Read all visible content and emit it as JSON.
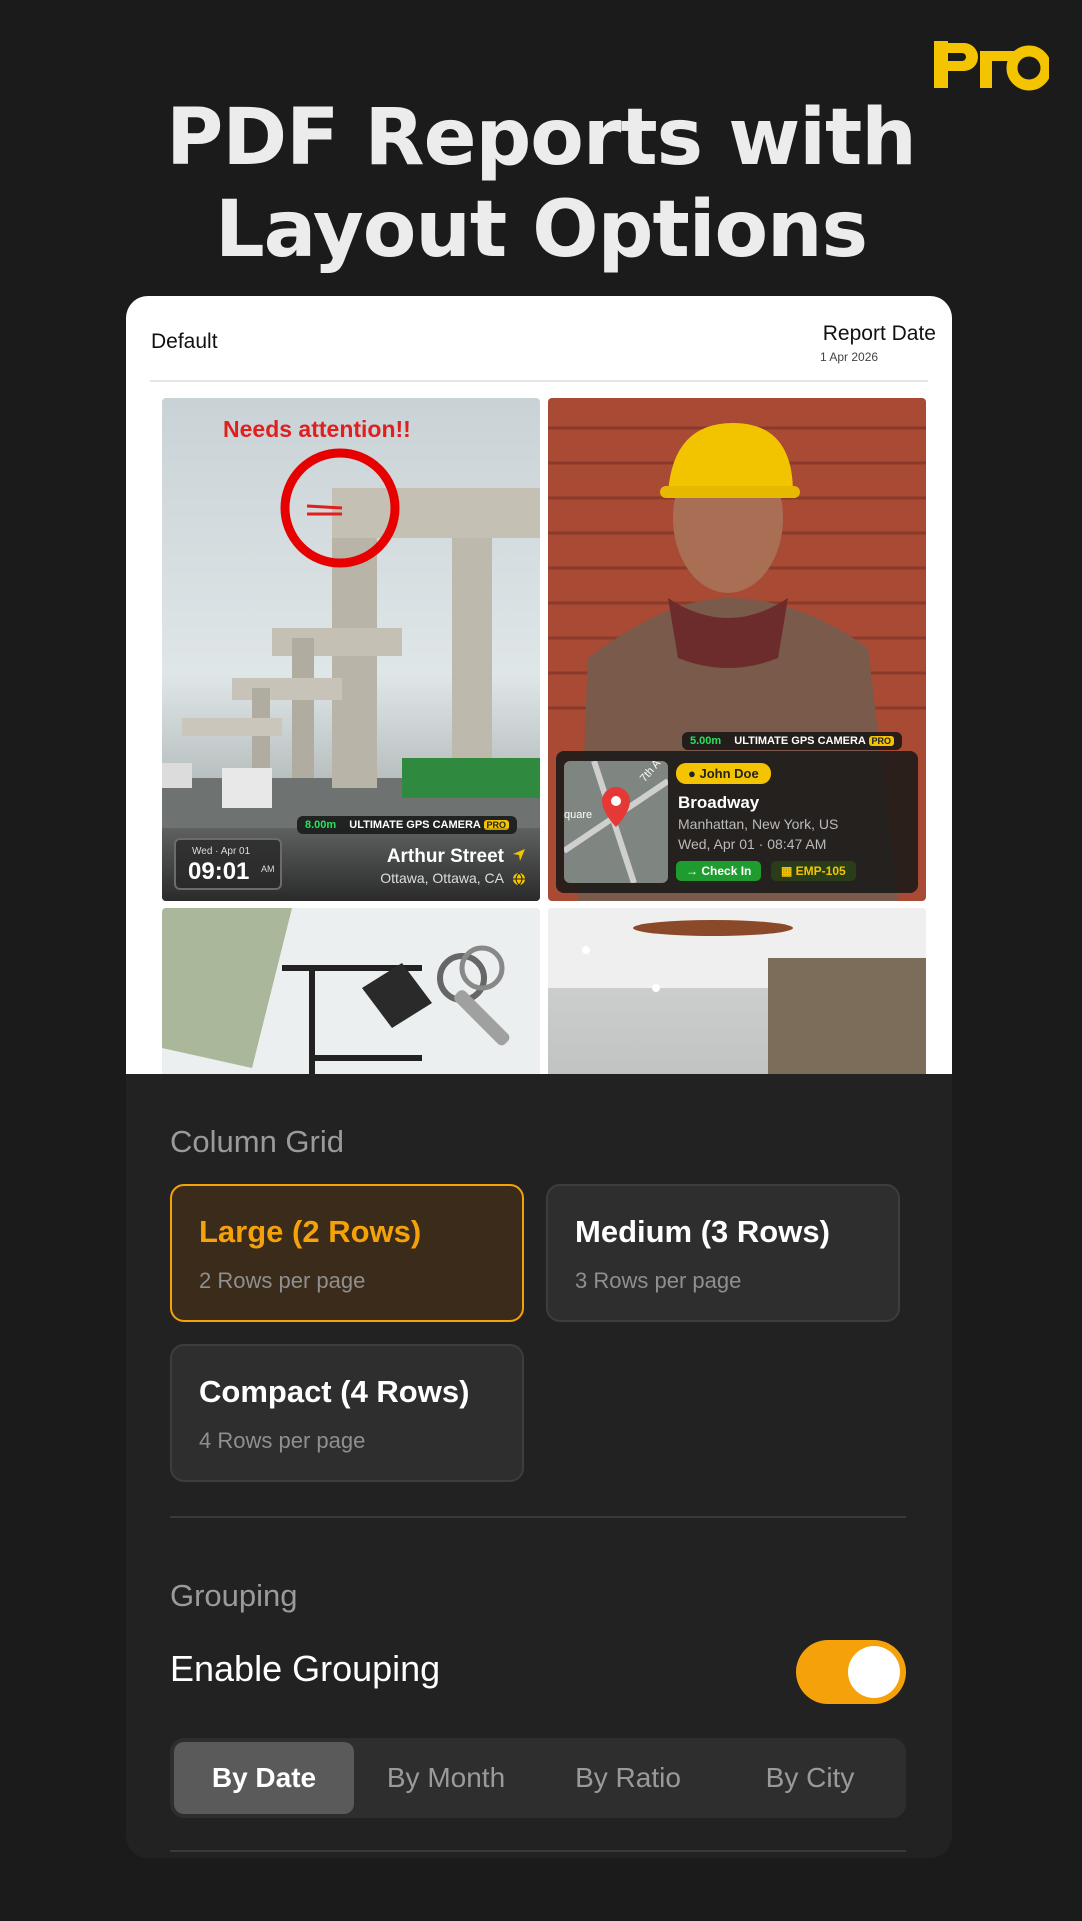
{
  "hero": {
    "line1": "PDF Reports with",
    "line2": "Layout Options"
  },
  "brand": {
    "logo_text": "pro",
    "accent": "#f5c400"
  },
  "report": {
    "layout_name": "Default",
    "date_label": "Report Date",
    "date_value": "1 Apr 2026"
  },
  "photos": {
    "photo1": {
      "annotation": "Needs attention!!",
      "distance": "8.00m",
      "camera": "ULTIMATE GPS CAMERA",
      "pro_tag": "PRO",
      "date": "Wed · Apr 01",
      "time": "09:01",
      "ampm": "AM",
      "street": "Arthur Street",
      "city": "Ottawa, Ottawa, CA"
    },
    "photo2": {
      "distance": "5.00m",
      "camera": "ULTIMATE GPS CAMERA",
      "pro_tag": "PRO",
      "map_label_1": "7th A",
      "map_label_2": "quare",
      "user": "John Doe",
      "street": "Broadway",
      "city": "Manhattan, New York, US",
      "datetime": "Wed, Apr 01 · 08:47 AM",
      "status": "Check In",
      "employee": "EMP-105"
    }
  },
  "column_grid": {
    "title": "Column Grid",
    "options": [
      {
        "title": "Large (2 Rows)",
        "sub": "2 Rows per page",
        "selected": true
      },
      {
        "title": "Medium (3 Rows)",
        "sub": "3 Rows per page",
        "selected": false
      },
      {
        "title": "Compact (4 Rows)",
        "sub": "4 Rows per page",
        "selected": false
      }
    ]
  },
  "grouping": {
    "title": "Grouping",
    "toggle_label": "Enable Grouping",
    "enabled": true,
    "tabs": [
      "By Date",
      "By Month",
      "By Ratio",
      "By City"
    ],
    "active_tab": "By Date"
  },
  "colors": {
    "accent_orange": "#f5a20a",
    "background": "#1b1b1b",
    "panel": "#222222"
  }
}
